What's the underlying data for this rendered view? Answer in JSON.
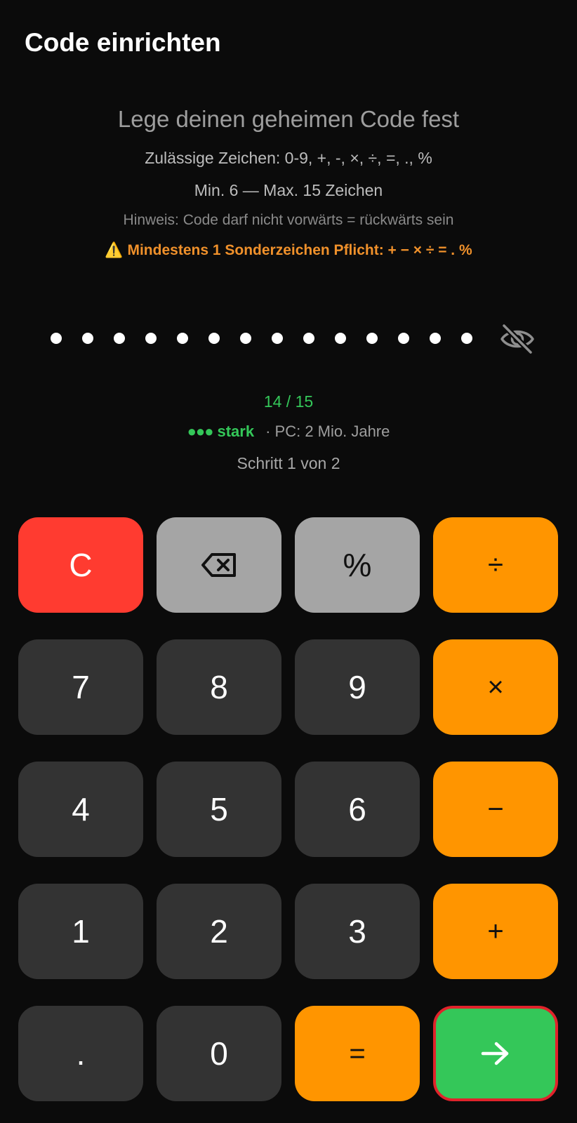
{
  "header": {
    "title": "Code einrichten"
  },
  "instructions": {
    "subtitle": "Lege deinen geheimen Code fest",
    "allowed_chars": "Zulässige Zeichen: 0-9, +, -, ×, ÷, =, ., %",
    "length_rule": "Min. 6 — Max. 15 Zeichen",
    "hint": "Hinweis: Code darf nicht vorwärts = rückwärts sein",
    "warning_icon": "⚠️",
    "warning": "Mindestens 1 Sonderzeichen Pflicht: + − × ÷ = . %"
  },
  "code_display": {
    "entered_length": 14,
    "eye_icon": "eye-off-icon"
  },
  "status": {
    "count": "14 / 15",
    "strength_dots": "●●●",
    "strength_label": "stark",
    "crack_time": "· PC: 2 Mio. Jahre",
    "step": "Schritt 1 von 2"
  },
  "keypad": {
    "clear": "C",
    "backspace_icon": "backspace-icon",
    "percent": "%",
    "divide": "÷",
    "seven": "7",
    "eight": "8",
    "nine": "9",
    "multiply": "×",
    "four": "4",
    "five": "5",
    "six": "6",
    "minus": "−",
    "one": "1",
    "two": "2",
    "three": "3",
    "plus": "+",
    "decimal": ".",
    "zero": "0",
    "equals": "=",
    "next_icon": "arrow-right-icon"
  },
  "colors": {
    "background": "#0b0b0b",
    "accent_orange": "#ff9500",
    "clear_red": "#ff3b30",
    "function_gray": "#a5a5a5",
    "digit_dark": "#333333",
    "confirm_green": "#34c759",
    "warning_orange": "#f0912b",
    "highlight_border": "#e0232b"
  }
}
